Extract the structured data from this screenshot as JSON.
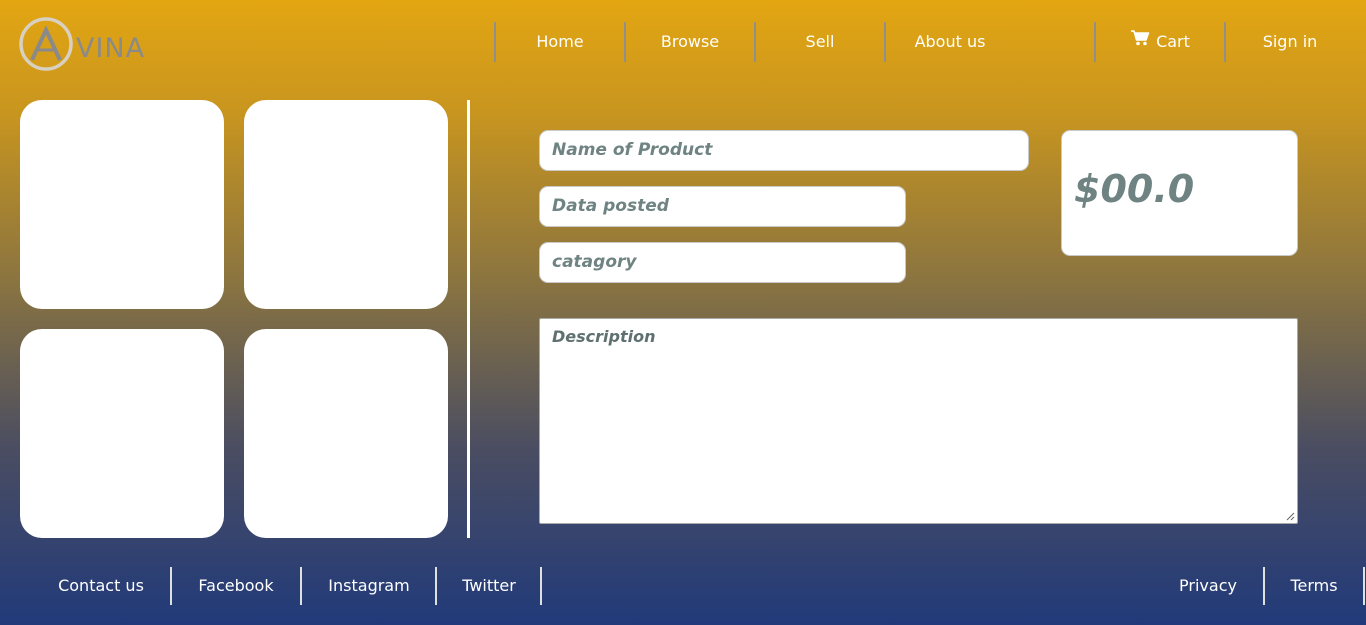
{
  "brand": {
    "logo_text": "VINA"
  },
  "nav": {
    "home": "Home",
    "browse": "Browse",
    "sell": "Sell",
    "about": "About us",
    "cart": "Cart",
    "signin": "Sign in"
  },
  "listing": {
    "product_name_placeholder": "Name of Product",
    "date_posted_placeholder": "Data posted",
    "category_placeholder": "catagory",
    "price": "$00.0",
    "description_placeholder": "Description"
  },
  "footer": {
    "contact": "Contact us",
    "facebook": "Facebook",
    "instagram": "Instagram",
    "twitter": "Twitter",
    "privacy": "Privacy",
    "terms": "Terms"
  },
  "colors": {
    "gradient_top": "#e3a612",
    "gradient_bottom": "#213a7a",
    "field_text": "#6f8383"
  }
}
